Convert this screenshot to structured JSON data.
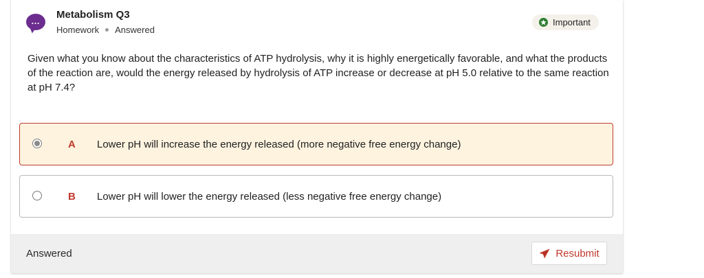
{
  "question_header": {
    "title": "Metabolism Q3",
    "category": "Homework",
    "status": "Answered",
    "badge_label": "Important",
    "avatar_glyph": "…"
  },
  "question": {
    "text": "Given what you know about the characteristics of ATP hydrolysis, why it is highly energetically favorable, and what the products of the reaction are, would the energy released by hydrolysis of ATP increase or decrease at pH 5.0 relative to the same reaction at pH 7.4?"
  },
  "options": [
    {
      "letter": "A",
      "text": "Lower pH will increase the energy released (more negative free energy change)",
      "selected": true
    },
    {
      "letter": "B",
      "text": "Lower pH will lower the energy released (less negative free energy change)",
      "selected": false
    }
  ],
  "footer": {
    "status": "Answered",
    "resubmit_label": "Resubmit"
  },
  "colors": {
    "accent": "#c0392b",
    "avatar": "#6c2d8f",
    "badge_icon": "#2f7d32",
    "selected_bg": "#fdf3df"
  },
  "icons": {
    "avatar": "chat-bubble-icon",
    "badge": "star-icon",
    "resubmit": "send-icon"
  }
}
